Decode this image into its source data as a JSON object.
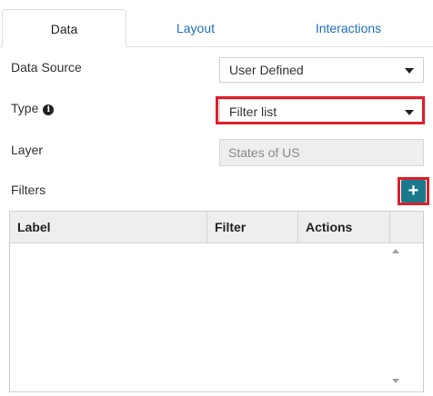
{
  "tabs": [
    "Data",
    "Layout",
    "Interactions"
  ],
  "fields": {
    "data_source": {
      "label": "Data Source",
      "value": "User Defined"
    },
    "type": {
      "label": "Type",
      "value": "Filter list"
    },
    "layer": {
      "label": "Layer",
      "value": "States of US"
    },
    "filters": {
      "label": "Filters",
      "add": "+"
    }
  },
  "table": {
    "columns": [
      "Label",
      "Filter",
      "Actions"
    ]
  },
  "colors": {
    "highlight": "#e01d2a",
    "accent": "#1a7a8c",
    "link": "#1f6fbf"
  },
  "icons": {
    "info": "info-icon",
    "caret": "caret-down-icon",
    "add": "plus-icon"
  }
}
